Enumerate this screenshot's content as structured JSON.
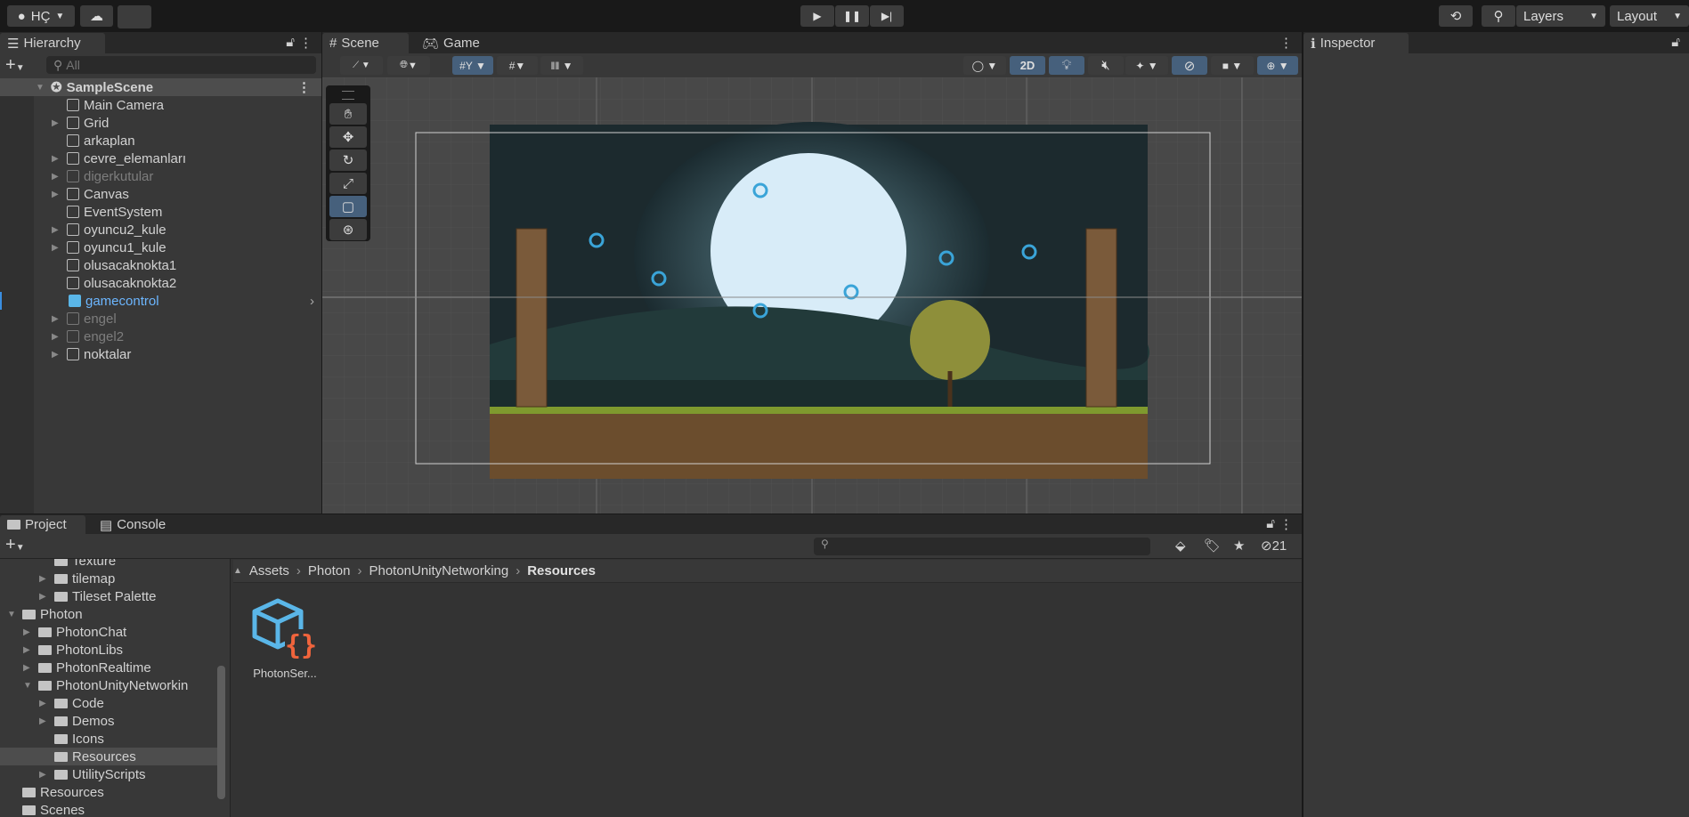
{
  "toolbar": {
    "account": "HÇ",
    "layers": "Layers",
    "layout": "Layout"
  },
  "hierarchy": {
    "tab": "Hierarchy",
    "search_placeholder": "All",
    "scene": "SampleScene",
    "items": [
      {
        "label": "Main Camera",
        "expand": false,
        "dim": false
      },
      {
        "label": "Grid",
        "expand": true,
        "dim": false
      },
      {
        "label": "arkaplan",
        "expand": false,
        "dim": false
      },
      {
        "label": "cevre_elemanları",
        "expand": true,
        "dim": false
      },
      {
        "label": "digerkutular",
        "expand": true,
        "dim": true
      },
      {
        "label": "Canvas",
        "expand": true,
        "dim": false
      },
      {
        "label": "EventSystem",
        "expand": false,
        "dim": false
      },
      {
        "label": "oyuncu2_kule",
        "expand": true,
        "dim": false
      },
      {
        "label": "oyuncu1_kule",
        "expand": true,
        "dim": false
      },
      {
        "label": "olusacaknokta1",
        "expand": false,
        "dim": false
      },
      {
        "label": "olusacaknokta2",
        "expand": false,
        "dim": false
      },
      {
        "label": "gamecontrol",
        "expand": false,
        "dim": false,
        "selected": true
      },
      {
        "label": "engel",
        "expand": true,
        "dim": true
      },
      {
        "label": "engel2",
        "expand": true,
        "dim": true
      },
      {
        "label": "noktalar",
        "expand": true,
        "dim": false
      }
    ]
  },
  "scene": {
    "tab_scene": "Scene",
    "tab_game": "Game",
    "btn_2d": "2D"
  },
  "inspector": {
    "tab": "Inspector"
  },
  "project": {
    "tab_project": "Project",
    "tab_console": "Console",
    "hidden_count": "21",
    "breadcrumb": [
      "Assets",
      "Photon",
      "PhotonUnityNetworking",
      "Resources"
    ],
    "tree": [
      {
        "label": "Texture",
        "indent": 3,
        "arrow": false
      },
      {
        "label": "tilemap",
        "indent": 3,
        "arrow": true
      },
      {
        "label": "Tileset Palette",
        "indent": 3,
        "arrow": true
      },
      {
        "label": "Photon",
        "indent": 1,
        "arrow": true,
        "open": true
      },
      {
        "label": "PhotonChat",
        "indent": 2,
        "arrow": true
      },
      {
        "label": "PhotonLibs",
        "indent": 2,
        "arrow": true
      },
      {
        "label": "PhotonRealtime",
        "indent": 2,
        "arrow": true
      },
      {
        "label": "PhotonUnityNetworkin",
        "indent": 2,
        "arrow": true,
        "open": true
      },
      {
        "label": "Code",
        "indent": 3,
        "arrow": true
      },
      {
        "label": "Demos",
        "indent": 3,
        "arrow": true
      },
      {
        "label": "Icons",
        "indent": 3,
        "arrow": false
      },
      {
        "label": "Resources",
        "indent": 3,
        "arrow": false,
        "selected": true
      },
      {
        "label": "UtilityScripts",
        "indent": 3,
        "arrow": true
      },
      {
        "label": "Resources",
        "indent": 1,
        "arrow": false
      },
      {
        "label": "Scenes",
        "indent": 1,
        "arrow": false
      }
    ],
    "asset": "PhotonSer..."
  }
}
